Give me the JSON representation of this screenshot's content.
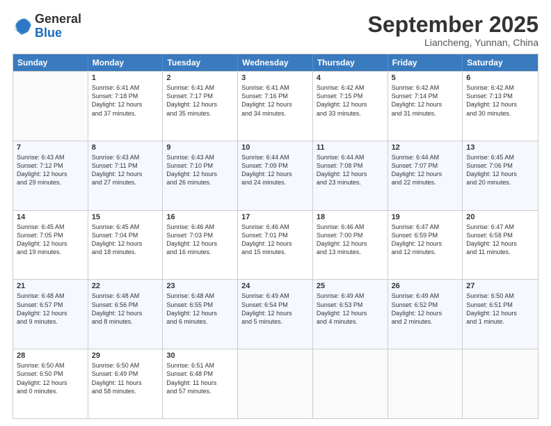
{
  "logo": {
    "general": "General",
    "blue": "Blue"
  },
  "title": "September 2025",
  "location": "Liancheng, Yunnan, China",
  "days": [
    "Sunday",
    "Monday",
    "Tuesday",
    "Wednesday",
    "Thursday",
    "Friday",
    "Saturday"
  ],
  "weeks": [
    [
      {
        "day": "",
        "info": ""
      },
      {
        "day": "1",
        "info": "Sunrise: 6:41 AM\nSunset: 7:18 PM\nDaylight: 12 hours\nand 37 minutes."
      },
      {
        "day": "2",
        "info": "Sunrise: 6:41 AM\nSunset: 7:17 PM\nDaylight: 12 hours\nand 35 minutes."
      },
      {
        "day": "3",
        "info": "Sunrise: 6:41 AM\nSunset: 7:16 PM\nDaylight: 12 hours\nand 34 minutes."
      },
      {
        "day": "4",
        "info": "Sunrise: 6:42 AM\nSunset: 7:15 PM\nDaylight: 12 hours\nand 33 minutes."
      },
      {
        "day": "5",
        "info": "Sunrise: 6:42 AM\nSunset: 7:14 PM\nDaylight: 12 hours\nand 31 minutes."
      },
      {
        "day": "6",
        "info": "Sunrise: 6:42 AM\nSunset: 7:13 PM\nDaylight: 12 hours\nand 30 minutes."
      }
    ],
    [
      {
        "day": "7",
        "info": "Sunrise: 6:43 AM\nSunset: 7:12 PM\nDaylight: 12 hours\nand 29 minutes."
      },
      {
        "day": "8",
        "info": "Sunrise: 6:43 AM\nSunset: 7:11 PM\nDaylight: 12 hours\nand 27 minutes."
      },
      {
        "day": "9",
        "info": "Sunrise: 6:43 AM\nSunset: 7:10 PM\nDaylight: 12 hours\nand 26 minutes."
      },
      {
        "day": "10",
        "info": "Sunrise: 6:44 AM\nSunset: 7:09 PM\nDaylight: 12 hours\nand 24 minutes."
      },
      {
        "day": "11",
        "info": "Sunrise: 6:44 AM\nSunset: 7:08 PM\nDaylight: 12 hours\nand 23 minutes."
      },
      {
        "day": "12",
        "info": "Sunrise: 6:44 AM\nSunset: 7:07 PM\nDaylight: 12 hours\nand 22 minutes."
      },
      {
        "day": "13",
        "info": "Sunrise: 6:45 AM\nSunset: 7:06 PM\nDaylight: 12 hours\nand 20 minutes."
      }
    ],
    [
      {
        "day": "14",
        "info": "Sunrise: 6:45 AM\nSunset: 7:05 PM\nDaylight: 12 hours\nand 19 minutes."
      },
      {
        "day": "15",
        "info": "Sunrise: 6:45 AM\nSunset: 7:04 PM\nDaylight: 12 hours\nand 18 minutes."
      },
      {
        "day": "16",
        "info": "Sunrise: 6:46 AM\nSunset: 7:03 PM\nDaylight: 12 hours\nand 16 minutes."
      },
      {
        "day": "17",
        "info": "Sunrise: 6:46 AM\nSunset: 7:01 PM\nDaylight: 12 hours\nand 15 minutes."
      },
      {
        "day": "18",
        "info": "Sunrise: 6:46 AM\nSunset: 7:00 PM\nDaylight: 12 hours\nand 13 minutes."
      },
      {
        "day": "19",
        "info": "Sunrise: 6:47 AM\nSunset: 6:59 PM\nDaylight: 12 hours\nand 12 minutes."
      },
      {
        "day": "20",
        "info": "Sunrise: 6:47 AM\nSunset: 6:58 PM\nDaylight: 12 hours\nand 11 minutes."
      }
    ],
    [
      {
        "day": "21",
        "info": "Sunrise: 6:48 AM\nSunset: 6:57 PM\nDaylight: 12 hours\nand 9 minutes."
      },
      {
        "day": "22",
        "info": "Sunrise: 6:48 AM\nSunset: 6:56 PM\nDaylight: 12 hours\nand 8 minutes."
      },
      {
        "day": "23",
        "info": "Sunrise: 6:48 AM\nSunset: 6:55 PM\nDaylight: 12 hours\nand 6 minutes."
      },
      {
        "day": "24",
        "info": "Sunrise: 6:49 AM\nSunset: 6:54 PM\nDaylight: 12 hours\nand 5 minutes."
      },
      {
        "day": "25",
        "info": "Sunrise: 6:49 AM\nSunset: 6:53 PM\nDaylight: 12 hours\nand 4 minutes."
      },
      {
        "day": "26",
        "info": "Sunrise: 6:49 AM\nSunset: 6:52 PM\nDaylight: 12 hours\nand 2 minutes."
      },
      {
        "day": "27",
        "info": "Sunrise: 6:50 AM\nSunset: 6:51 PM\nDaylight: 12 hours\nand 1 minute."
      }
    ],
    [
      {
        "day": "28",
        "info": "Sunrise: 6:50 AM\nSunset: 6:50 PM\nDaylight: 12 hours\nand 0 minutes."
      },
      {
        "day": "29",
        "info": "Sunrise: 6:50 AM\nSunset: 6:49 PM\nDaylight: 11 hours\nand 58 minutes."
      },
      {
        "day": "30",
        "info": "Sunrise: 6:51 AM\nSunset: 6:48 PM\nDaylight: 11 hours\nand 57 minutes."
      },
      {
        "day": "",
        "info": ""
      },
      {
        "day": "",
        "info": ""
      },
      {
        "day": "",
        "info": ""
      },
      {
        "day": "",
        "info": ""
      }
    ]
  ]
}
